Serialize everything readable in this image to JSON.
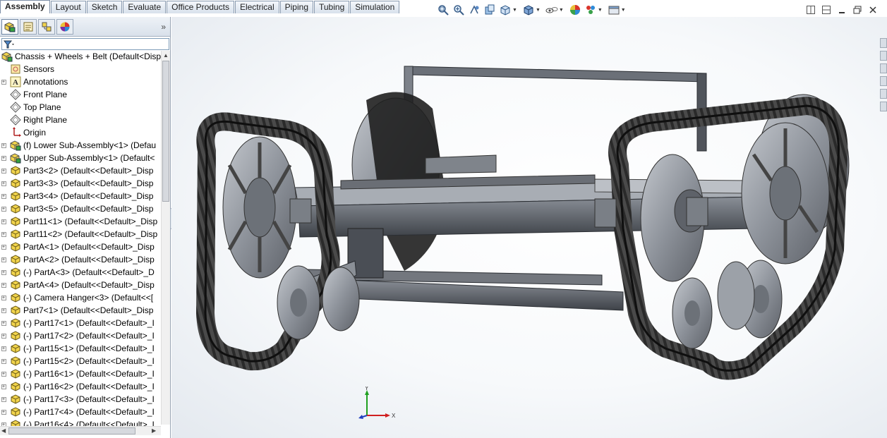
{
  "command_tabs": [
    "Assembly",
    "Layout",
    "Sketch",
    "Evaluate",
    "Office Products",
    "Electrical",
    "Piping",
    "Tubing",
    "Simulation"
  ],
  "active_tab": "Assembly",
  "view_toolbar": {
    "icons": [
      "zoom-to-fit-icon",
      "zoom-to-area-icon",
      "previous-view-icon",
      "section-view-icon",
      "view-orientation-icon",
      "display-style-icon",
      "hide-show-items-icon",
      "edit-appearance-icon",
      "apply-scene-icon",
      "view-settings-icon"
    ]
  },
  "feature_manager": {
    "tabs": [
      "featuremanager-tab",
      "propertymanager-tab",
      "configurationmanager-tab",
      "displaymanager-tab"
    ],
    "more": "»",
    "tree": [
      {
        "label": "Chassis + Wheels + Belt  (Default<Disp",
        "icon": "assembly",
        "root": true,
        "expand": "",
        "ind": 0
      },
      {
        "label": "Sensors",
        "icon": "sensor",
        "expand": "",
        "ind": 1
      },
      {
        "label": "Annotations",
        "icon": "annotation",
        "expand": "+",
        "ind": 1
      },
      {
        "label": "Front Plane",
        "icon": "plane",
        "expand": "",
        "ind": 1
      },
      {
        "label": "Top Plane",
        "icon": "plane",
        "expand": "",
        "ind": 1
      },
      {
        "label": "Right Plane",
        "icon": "plane",
        "expand": "",
        "ind": 1
      },
      {
        "label": "Origin",
        "icon": "origin",
        "expand": "",
        "ind": 1
      },
      {
        "label": "(f) Lower Sub-Assembly<1> (Defau",
        "icon": "subassembly",
        "expand": "+",
        "ind": 1
      },
      {
        "label": "Upper Sub-Assembly<1> (Default<",
        "icon": "subassembly",
        "expand": "+",
        "ind": 1
      },
      {
        "label": "Part3<2> (Default<<Default>_Disp",
        "icon": "part",
        "expand": "+",
        "ind": 1
      },
      {
        "label": "Part3<3> (Default<<Default>_Disp",
        "icon": "part",
        "expand": "+",
        "ind": 1
      },
      {
        "label": "Part3<4> (Default<<Default>_Disp",
        "icon": "part",
        "expand": "+",
        "ind": 1
      },
      {
        "label": "Part3<5> (Default<<Default>_Disp",
        "icon": "part",
        "expand": "+",
        "ind": 1
      },
      {
        "label": "Part11<1> (Default<<Default>_Disp",
        "icon": "part",
        "expand": "+",
        "ind": 1
      },
      {
        "label": "Part11<2> (Default<<Default>_Disp",
        "icon": "part",
        "expand": "+",
        "ind": 1
      },
      {
        "label": "PartA<1> (Default<<Default>_Disp",
        "icon": "part",
        "expand": "+",
        "ind": 1
      },
      {
        "label": "PartA<2> (Default<<Default>_Disp",
        "icon": "part",
        "expand": "+",
        "ind": 1
      },
      {
        "label": "(-) PartA<3> (Default<<Default>_D",
        "icon": "part",
        "expand": "+",
        "ind": 1
      },
      {
        "label": "PartA<4> (Default<<Default>_Disp",
        "icon": "part",
        "expand": "+",
        "ind": 1
      },
      {
        "label": "(-) Camera Hanger<3> (Default<<[",
        "icon": "part",
        "expand": "+",
        "ind": 1
      },
      {
        "label": "Part7<1> (Default<<Default>_Disp",
        "icon": "part",
        "expand": "+",
        "ind": 1
      },
      {
        "label": "(-) Part17<1> (Default<<Default>_I",
        "icon": "part",
        "expand": "+",
        "ind": 1
      },
      {
        "label": "(-) Part17<2> (Default<<Default>_I",
        "icon": "part",
        "expand": "+",
        "ind": 1
      },
      {
        "label": "(-) Part15<1> (Default<<Default>_I",
        "icon": "part",
        "expand": "+",
        "ind": 1
      },
      {
        "label": "(-) Part15<2> (Default<<Default>_I",
        "icon": "part",
        "expand": "+",
        "ind": 1
      },
      {
        "label": "(-) Part16<1> (Default<<Default>_I",
        "icon": "part",
        "expand": "+",
        "ind": 1
      },
      {
        "label": "(-) Part16<2> (Default<<Default>_I",
        "icon": "part",
        "expand": "+",
        "ind": 1
      },
      {
        "label": "(-) Part17<3> (Default<<Default>_I",
        "icon": "part",
        "expand": "+",
        "ind": 1
      },
      {
        "label": "(-) Part17<4> (Default<<Default>_I",
        "icon": "part",
        "expand": "+",
        "ind": 1
      },
      {
        "label": "(-) Part16<4> (Default<<Default>_I",
        "icon": "part",
        "expand": "+",
        "ind": 1
      }
    ]
  },
  "triad": {
    "y_label": "Y",
    "x_label": "X"
  },
  "colors": {
    "tab_active": "#ffffff",
    "frame_gray": "#55595f",
    "belt_black": "#1a1a1a",
    "wheel_gray": "#8e939b",
    "axis_x": "#d02020",
    "axis_y": "#20a020",
    "axis_z": "#2040c0"
  }
}
